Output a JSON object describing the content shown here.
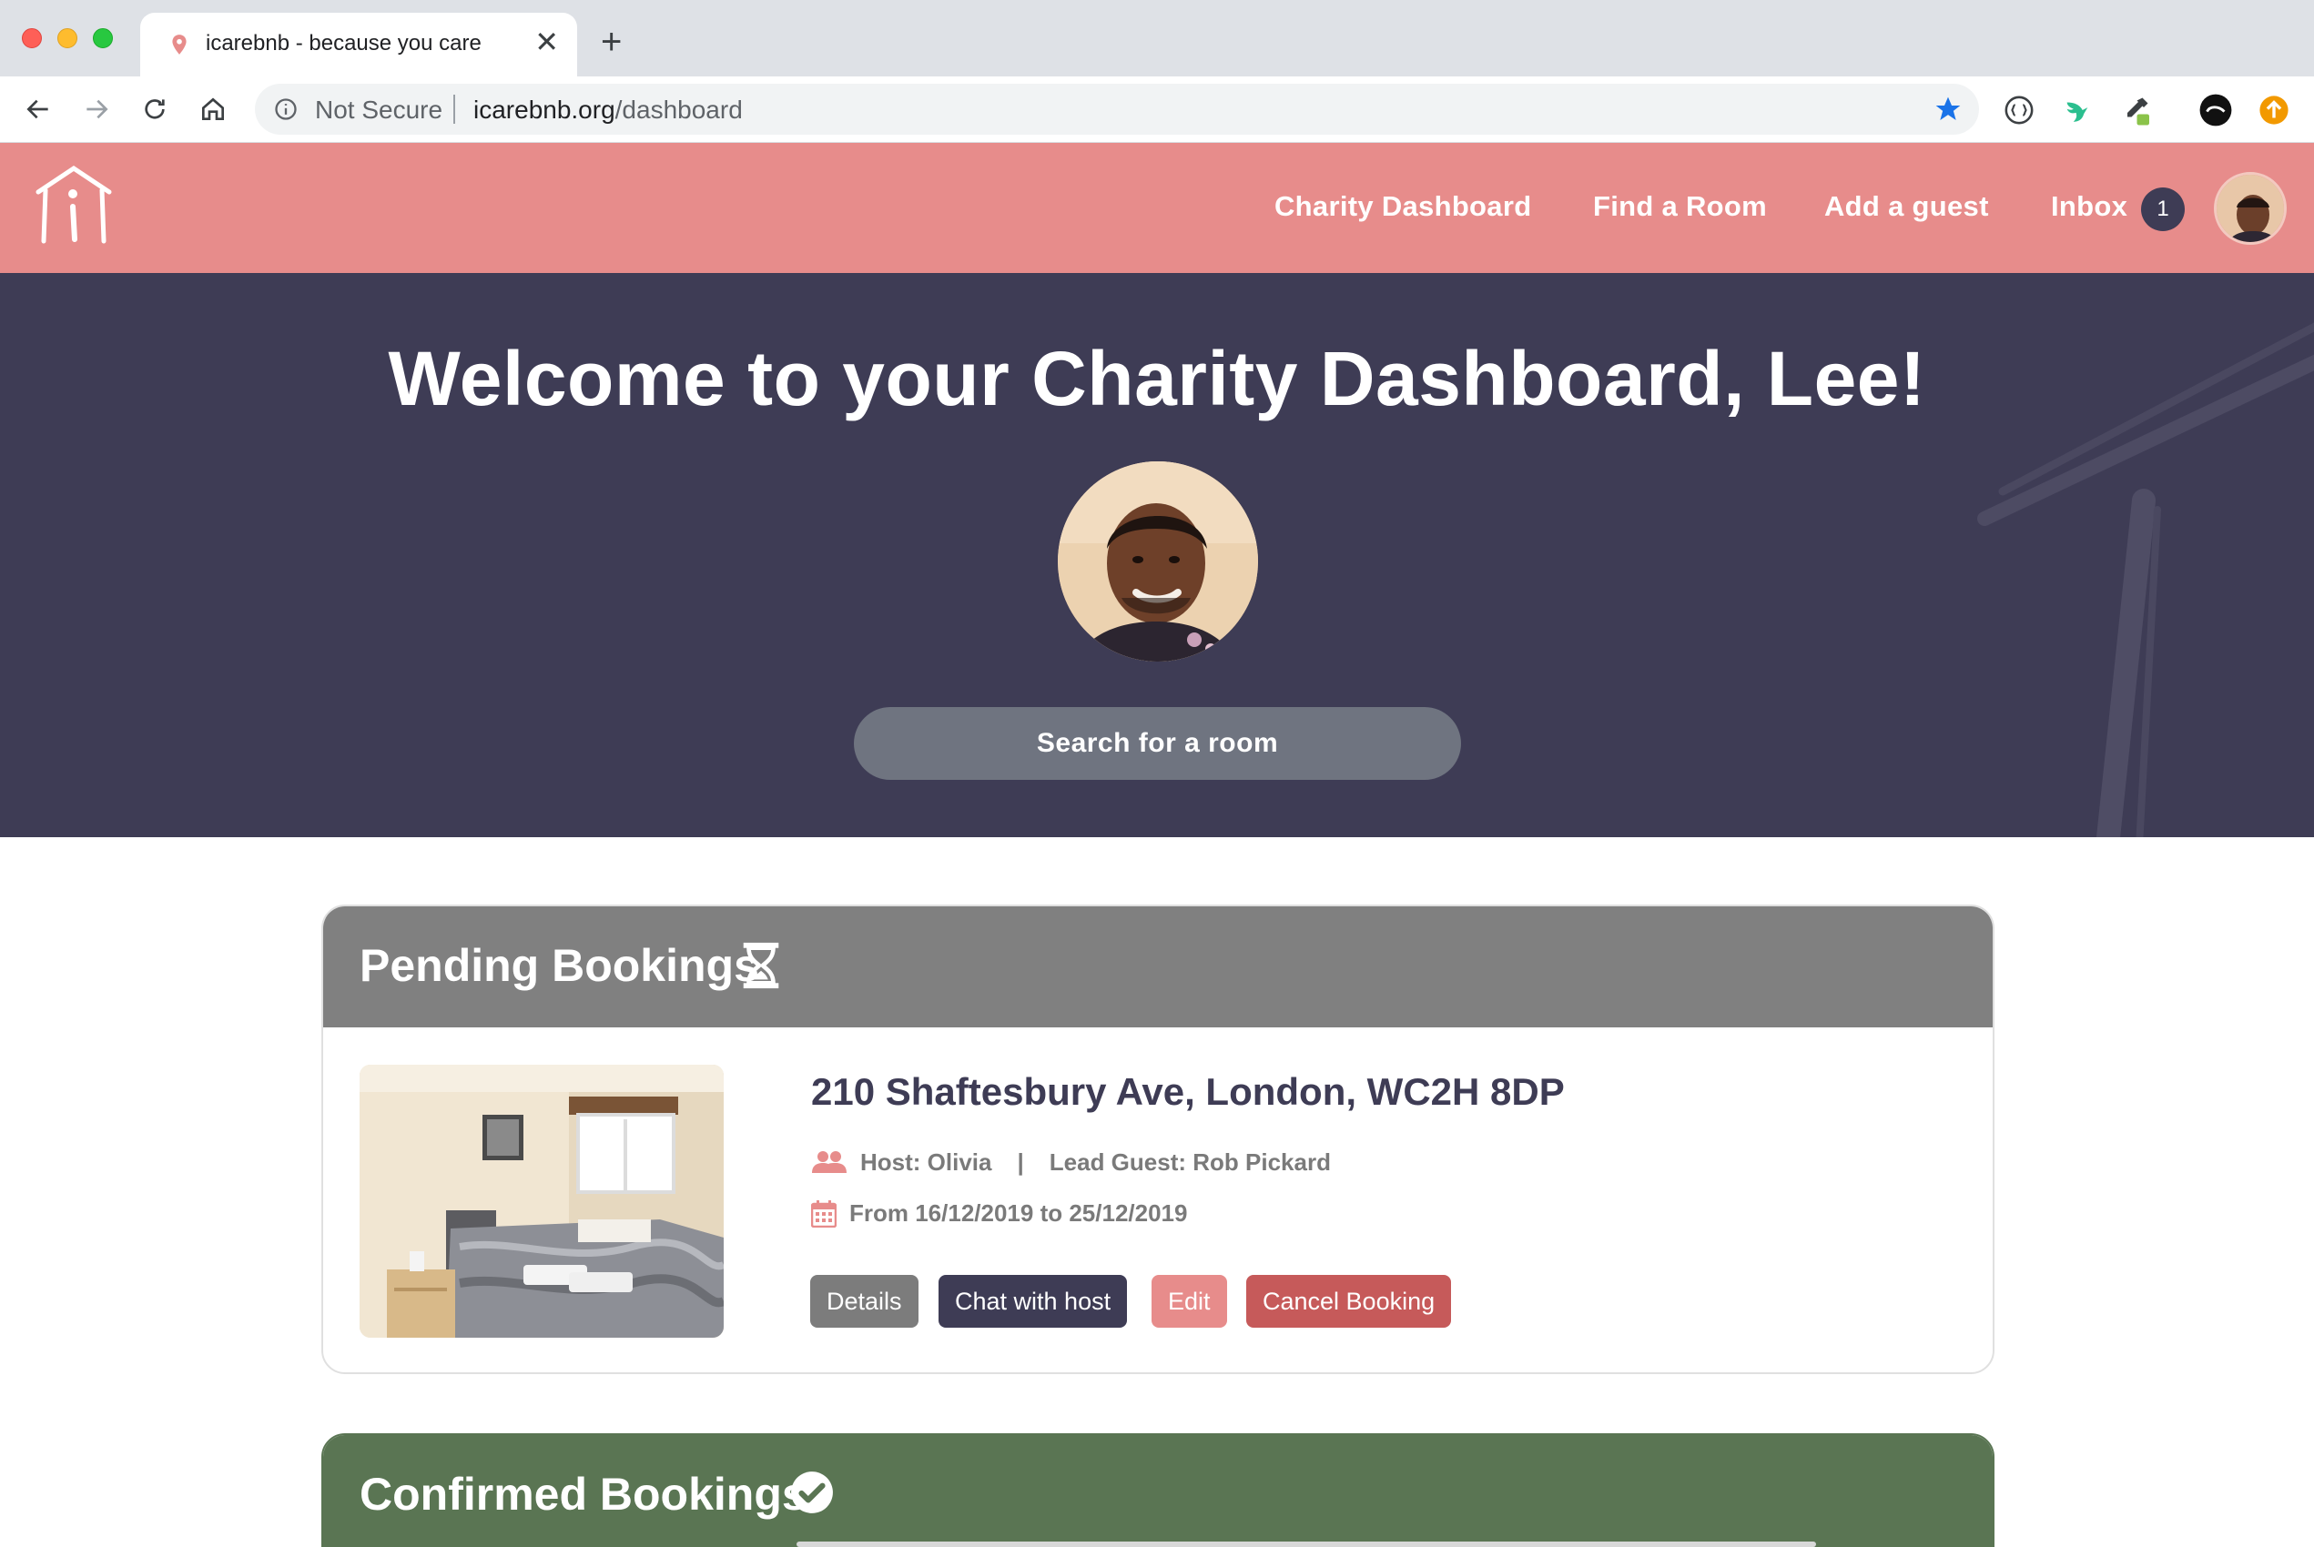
{
  "browser": {
    "tab_title": "icarebnb - because you care",
    "tab_close": "✕",
    "new_tab": "+",
    "security_label": "Not Secure",
    "url_host": "icarebnb.org",
    "url_path": "/dashboard"
  },
  "header": {
    "nav": [
      {
        "label": "Charity Dashboard"
      },
      {
        "label": "Find a Room"
      },
      {
        "label": "Add a guest"
      },
      {
        "label": "Inbox"
      }
    ],
    "inbox_count": "1"
  },
  "hero": {
    "title": "Welcome to your Charity Dashboard, Lee!",
    "search_button": "Search for a room"
  },
  "pending": {
    "title": "Pending Bookings",
    "booking": {
      "address": "210 Shaftesbury Ave, London, WC2H 8DP",
      "host": "Host: Olivia",
      "separator": "|",
      "lead_guest": "Lead Guest: Rob Pickard",
      "dates": "From 16/12/2019 to 25/12/2019",
      "buttons": {
        "details": "Details",
        "chat": "Chat with host",
        "edit": "Edit",
        "cancel": "Cancel Booking"
      }
    }
  },
  "confirmed": {
    "title": "Confirmed Bookings"
  },
  "colors": {
    "brand_pink": "#e78c8b",
    "brand_navy": "#3e3c55",
    "pending_grey": "#808080",
    "confirmed_green": "#5a7553",
    "cancel_red": "#c65a5a"
  }
}
